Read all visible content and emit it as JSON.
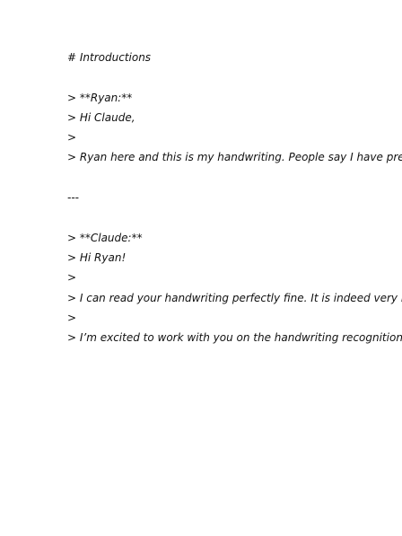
{
  "document": {
    "lines": [
      "# Introductions",
      "",
      "> **Ryan:**",
      "> Hi Claude,",
      ">",
      "> Ryan here and this is my handwriting. People say I have pretty neat",
      "",
      "---",
      "",
      "> **Claude:**",
      "> Hi Ryan!",
      ">",
      "> I can read your handwriting perfectly fine. It is indeed very neat and",
      ">",
      "> I’m excited to work with you on the handwriting recognition project."
    ]
  }
}
